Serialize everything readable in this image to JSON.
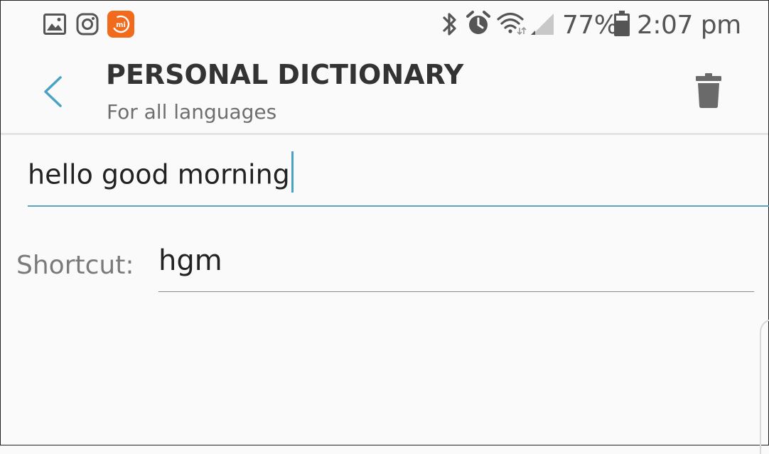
{
  "status_bar": {
    "notification_icons": [
      "gallery-icon",
      "instagram-icon",
      "mi-app-icon"
    ],
    "system_icons": [
      "bluetooth-icon",
      "alarm-icon",
      "wifi-icon",
      "signal-icon",
      "battery-icon"
    ],
    "battery_percent": "77%",
    "time": "2:07 pm",
    "mi_icon_color": "#f26a1b"
  },
  "app_bar": {
    "title": "PERSONAL DICTIONARY",
    "subtitle": "For all languages",
    "back_icon": "chevron-left-icon",
    "delete_icon": "trash-icon",
    "accent_color": "#4aa3c2"
  },
  "form": {
    "word_value": "hello good morning",
    "shortcut_label": "Shortcut:",
    "shortcut_value": "hgm"
  }
}
